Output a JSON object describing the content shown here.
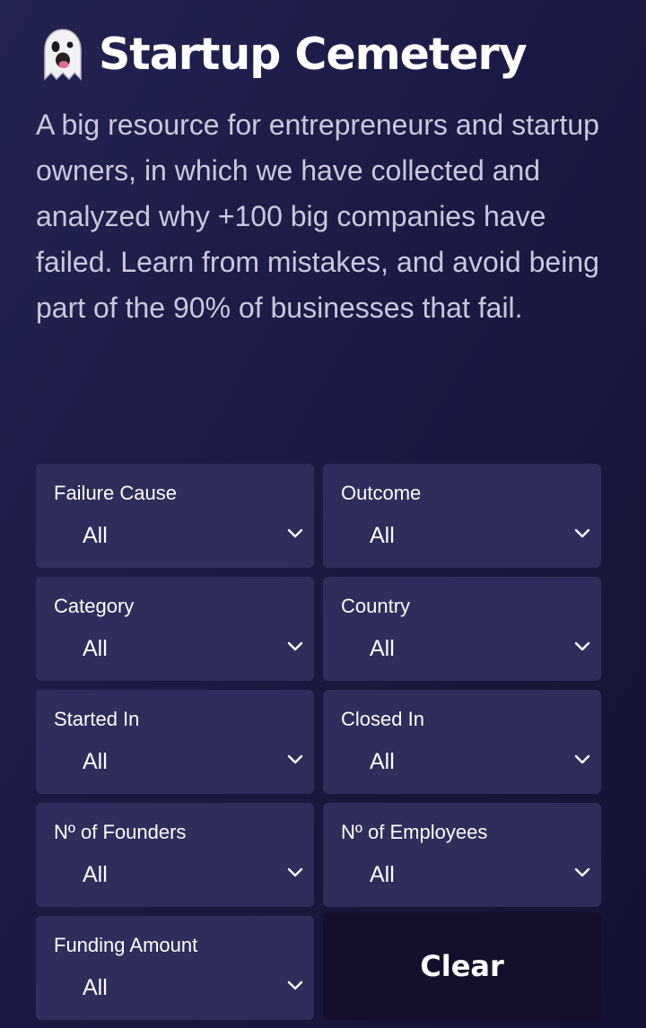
{
  "header": {
    "title": "Startup Cemetery",
    "icon": "ghost-icon",
    "description": "A big resource for entrepreneurs and startup owners, in which we have collected and analyzed why +100 big companies have failed. Learn from mistakes, and avoid being part of the 90% of businesses that fail."
  },
  "filters": [
    {
      "label": "Failure Cause",
      "value": "All"
    },
    {
      "label": "Outcome",
      "value": "All"
    },
    {
      "label": "Category",
      "value": "All"
    },
    {
      "label": "Country",
      "value": "All"
    },
    {
      "label": "Started In",
      "value": "All"
    },
    {
      "label": "Closed In",
      "value": "All"
    },
    {
      "label": "Nº of Founders",
      "value": "All"
    },
    {
      "label": "Nº of Employees",
      "value": "All"
    },
    {
      "label": "Funding Amount",
      "value": "All"
    }
  ],
  "clear_button": {
    "label": "Clear"
  },
  "colors": {
    "background": "#1f1d4a",
    "card": "#2e2d5b",
    "clear_button": "#150f2b",
    "text": "#ffffff",
    "muted_text": "#c9c8dc"
  }
}
